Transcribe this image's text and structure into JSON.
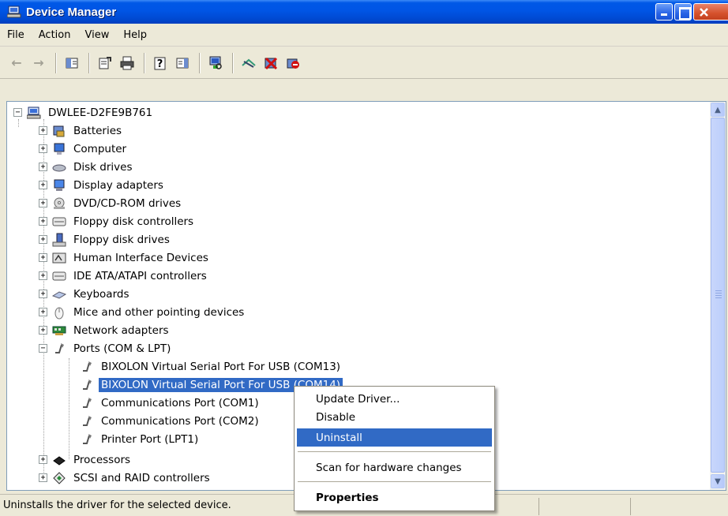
{
  "window": {
    "title": "Device Manager",
    "icon": "computer-icon",
    "colors": {
      "titlebar": "#0055e5",
      "selection": "#316ac5"
    }
  },
  "menubar": {
    "items": [
      "File",
      "Action",
      "View",
      "Help"
    ]
  },
  "toolbar": {
    "buttons": [
      {
        "icon": "back-arrow-icon"
      },
      {
        "icon": "forward-arrow-icon"
      },
      {
        "icon": "show-hide-tree-icon"
      },
      {
        "icon": "properties-icon"
      },
      {
        "icon": "print-icon"
      },
      {
        "icon": "help-icon"
      },
      {
        "icon": "show-hide-action-pane-icon"
      },
      {
        "icon": "scan-hardware-icon"
      },
      {
        "icon": "update-driver-icon"
      },
      {
        "icon": "uninstall-icon"
      },
      {
        "icon": "disable-icon"
      }
    ]
  },
  "tree": {
    "root": "DWLEE-D2FE9B761",
    "categories": [
      {
        "label": "Batteries",
        "icon": "battery-icon"
      },
      {
        "label": "Computer",
        "icon": "monitor-icon"
      },
      {
        "label": "Disk drives",
        "icon": "disk-drive-icon"
      },
      {
        "label": "Display adapters",
        "icon": "display-adapter-icon"
      },
      {
        "label": "DVD/CD-ROM drives",
        "icon": "cd-rom-icon"
      },
      {
        "label": "Floppy disk controllers",
        "icon": "controller-icon"
      },
      {
        "label": "Floppy disk drives",
        "icon": "floppy-drive-icon"
      },
      {
        "label": "Human Interface Devices",
        "icon": "hid-icon"
      },
      {
        "label": "IDE ATA/ATAPI controllers",
        "icon": "ide-controller-icon"
      },
      {
        "label": "Keyboards",
        "icon": "keyboard-icon"
      },
      {
        "label": "Mice and other pointing devices",
        "icon": "mouse-icon"
      },
      {
        "label": "Network adapters",
        "icon": "network-adapter-icon"
      },
      {
        "label": "Ports (COM & LPT)",
        "icon": "port-icon"
      }
    ],
    "ports": [
      "BIXOLON Virtual Serial Port For USB (COM13)",
      "BIXOLON Virtual Serial Port For USB (COM14)",
      "Communications Port (COM1)",
      "Communications Port (COM2)",
      "Printer Port (LPT1)"
    ],
    "after": [
      {
        "label": "Processors",
        "icon": "processor-icon"
      },
      {
        "label": "SCSI and RAID controllers",
        "icon": "scsi-icon"
      }
    ]
  },
  "context_menu": {
    "items": [
      "Update Driver...",
      "Disable",
      "Uninstall",
      "Scan for hardware changes",
      "Properties"
    ]
  },
  "statusbar": {
    "text": "Uninstalls the driver for the selected device."
  }
}
